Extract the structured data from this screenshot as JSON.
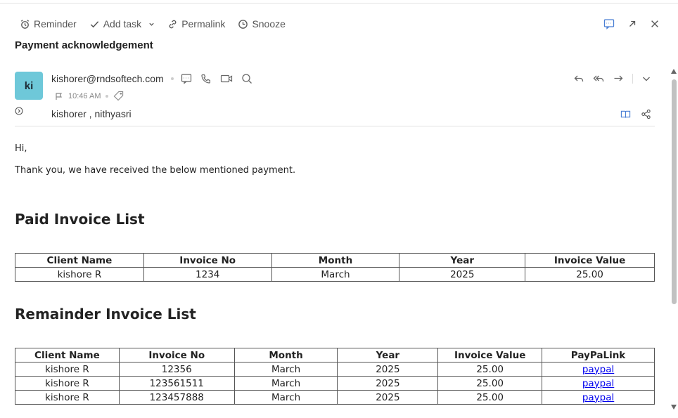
{
  "toolbar": {
    "reminder": "Reminder",
    "add_task": "Add task",
    "permalink": "Permalink",
    "snooze": "Snooze"
  },
  "subject": "Payment acknowledgement",
  "sender": {
    "initials": "ki",
    "email": "kishorer@rndsoftech.com",
    "time": "10:46 AM",
    "recipients": "kishorer , nithyasri"
  },
  "body": {
    "greeting": "Hi,",
    "message": "Thank you, we have received the below mentioned payment."
  },
  "paid": {
    "title": "Paid Invoice List",
    "headers": [
      "Client Name",
      "Invoice No",
      "Month",
      "Year",
      "Invoice Value"
    ],
    "rows": [
      [
        "kishore R",
        "1234",
        "March",
        "2025",
        "25.00"
      ]
    ]
  },
  "remainder": {
    "title": "Remainder Invoice List",
    "headers": [
      "Client Name",
      "Invoice No",
      "Month",
      "Year",
      "Invoice Value",
      "PayPaLink"
    ],
    "rows": [
      [
        "kishore R",
        "12356",
        "March",
        "2025",
        "25.00",
        "paypal"
      ],
      [
        "kishore R",
        "123561511",
        "March",
        "2025",
        "25.00",
        "paypal"
      ],
      [
        "kishore R",
        "123457888",
        "March",
        "2025",
        "25.00",
        "paypal"
      ]
    ]
  },
  "colors": {
    "avatar_bg": "#6ec8d9",
    "link": "#0000ee",
    "accent_icon": "#4a7fd4"
  },
  "icons": {
    "reminder": "alarm-clock-icon",
    "add_task": "checkmark-icon",
    "permalink": "link-icon",
    "snooze": "clock-icon",
    "chat": "chat-icon",
    "popout": "popout-icon",
    "close": "close-icon"
  }
}
